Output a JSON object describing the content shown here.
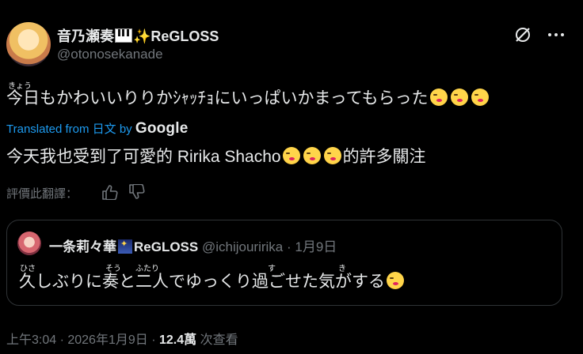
{
  "author": {
    "name": "音乃瀬奏",
    "name_suffix": "ReGLOSS",
    "handle": "@otonosekanade"
  },
  "icons": [
    "piano-icon",
    "sparkle-icon",
    "grok-icon",
    "more-icon",
    "kiss-emoji",
    "thumb-up-icon",
    "thumb-down-icon",
    "night-icon"
  ],
  "tweet": {
    "furigana": "きょう",
    "jp_text": "今日もかわいいりりかｼｬｯﾁｮにいっぱいかまってもらった",
    "translated_prefix": "Translated from 日文 by",
    "translated_engine": "Google",
    "zh_text_a": "今天我也受到了可愛的 Ririka Shacho",
    "zh_text_b": "的許多關注"
  },
  "rate": {
    "label": "評價此翻譯："
  },
  "quote": {
    "name": "一条莉々華",
    "name_suffix": "ReGLOSS",
    "handle": "@ichijouririka",
    "date": "· 1月9日",
    "furi_1": "ひさ",
    "furi_2": "そう",
    "furi_3": "ふたり",
    "furi_4": "す",
    "furi_5": "き",
    "text": "久しぶりに奏と二人でゆっくり過ごせた気がする"
  },
  "footer": {
    "time_date": "上午3:04 · 2026年1月9日 ·",
    "views": "12.4萬",
    "views_label": "次查看"
  },
  "colors": {
    "background": "#000000",
    "text": "#e7e9ea",
    "muted": "#71767b",
    "link": "#1d9bf0",
    "border": "#2f3336"
  }
}
